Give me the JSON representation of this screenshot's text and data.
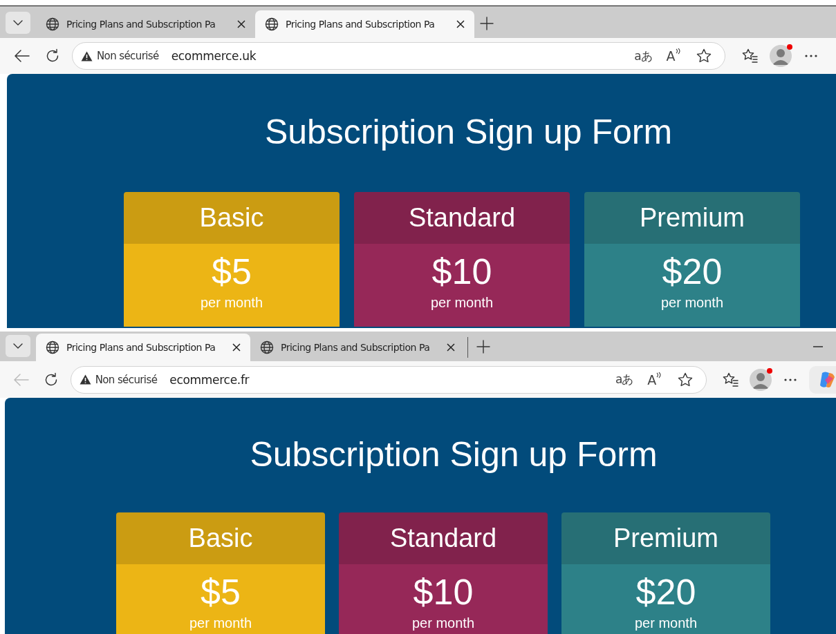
{
  "windows": [
    {
      "tabs": [
        {
          "title": "Pricing Plans and Subscription Pa",
          "selected": false
        },
        {
          "title": "Pricing Plans and Subscription Pa",
          "selected": true
        }
      ],
      "back_enabled": true,
      "tab_divider": false,
      "minimize_button": false,
      "copilot_button": false,
      "address": {
        "security": "Non sécurisé",
        "url": "ecommerce.uk"
      },
      "translate_glyph": "aあ",
      "read_aloud_glyph": "A",
      "page": {
        "heading": "Subscription Sign up Form",
        "plans": [
          {
            "name": "Basic",
            "price": "$5",
            "period": "per month",
            "color": "#ecb515"
          },
          {
            "name": "Standard",
            "price": "$10",
            "period": "per month",
            "color": "#962858"
          },
          {
            "name": "Premium",
            "price": "$20",
            "period": "per month",
            "color": "#2d8188"
          }
        ]
      }
    },
    {
      "tabs": [
        {
          "title": "Pricing Plans and Subscription Pa",
          "selected": true
        },
        {
          "title": "Pricing Plans and Subscription Pa",
          "selected": false
        }
      ],
      "back_enabled": false,
      "tab_divider": true,
      "minimize_button": true,
      "copilot_button": true,
      "address": {
        "security": "Non sécurisé",
        "url": "ecommerce.fr"
      },
      "translate_glyph": "aあ",
      "read_aloud_glyph": "A",
      "page": {
        "heading": "Subscription Sign up Form",
        "plans": [
          {
            "name": "Basic",
            "price": "$5",
            "period": "per month",
            "color": "#ecb515"
          },
          {
            "name": "Standard",
            "price": "$10",
            "period": "per month",
            "color": "#962858"
          },
          {
            "name": "Premium",
            "price": "$20",
            "period": "per month",
            "color": "#2d8188"
          }
        ]
      }
    }
  ]
}
